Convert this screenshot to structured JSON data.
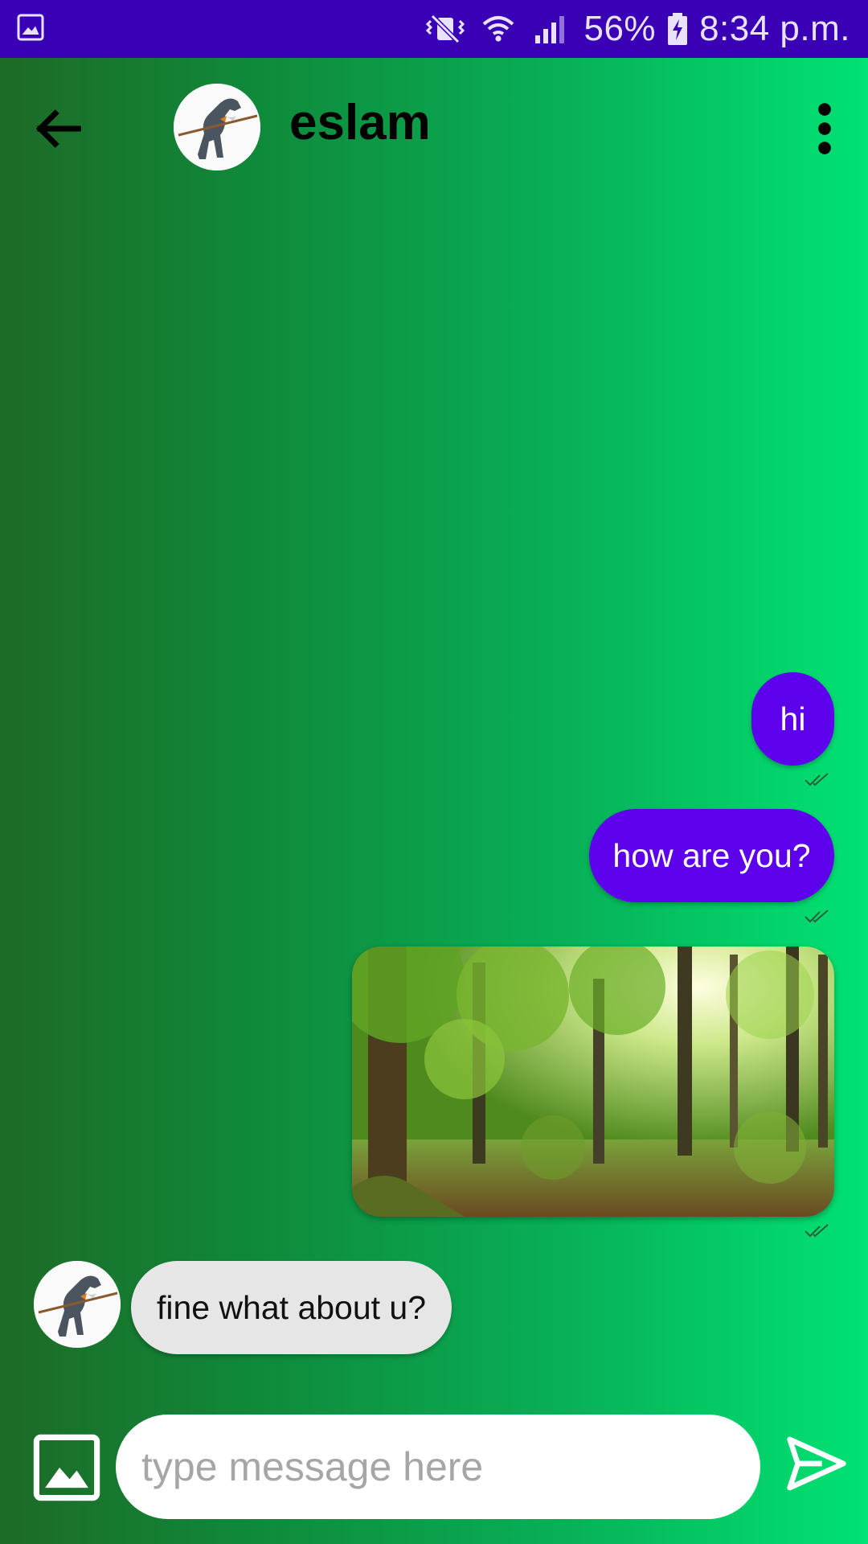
{
  "status_bar": {
    "battery": "56%",
    "time": "8:34 p.m."
  },
  "header": {
    "contact_name": "eslam"
  },
  "messages": [
    {
      "direction": "sent",
      "text": "hi"
    },
    {
      "direction": "sent",
      "text": "how are you?"
    },
    {
      "direction": "sent",
      "type": "image",
      "image": "forest-photo"
    },
    {
      "direction": "received",
      "text": "fine what about u?"
    }
  ],
  "composer": {
    "placeholder": "type message here",
    "value": ""
  },
  "colors": {
    "status_bar": "#3a00b6",
    "sent_bubble": "#5d00ec",
    "received_bubble": "#e6e6e6",
    "gradient_start": "#1d6a26",
    "gradient_end": "#00e273"
  }
}
